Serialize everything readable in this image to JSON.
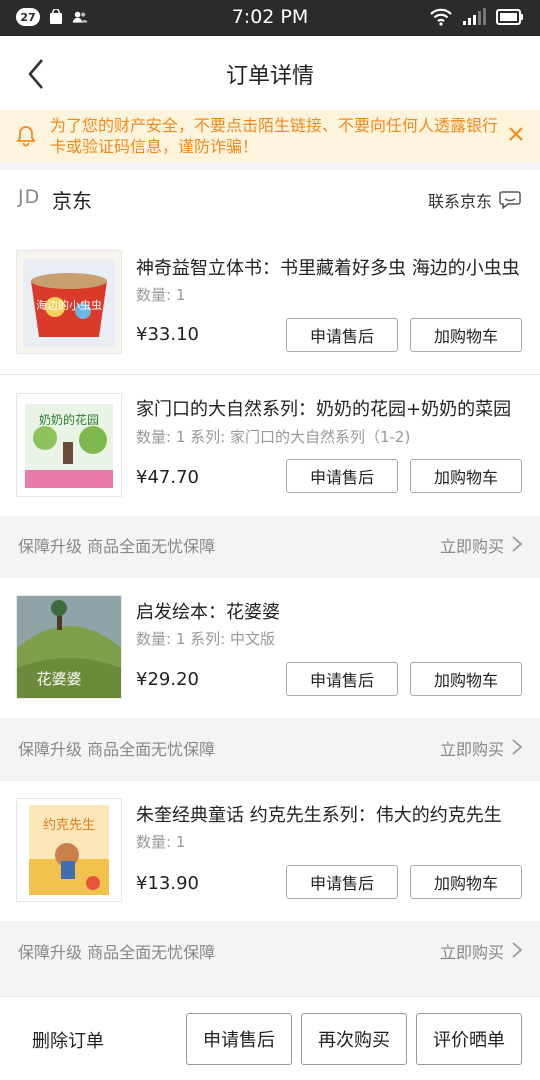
{
  "status_bar": {
    "notif_count": "27",
    "time": "7:02 PM"
  },
  "nav": {
    "title": "订单详情"
  },
  "warning": {
    "text": "为了您的财产安全，不要点击陌生链接、不要向任何人透露银行卡或验证码信息，谨防诈骗！"
  },
  "shop": {
    "logo": "JD",
    "name": "京东",
    "contact": "联系京东"
  },
  "items": [
    {
      "name": "神奇益智立体书：书里藏着好多虫 海边的小虫虫",
      "qty": "数量: 1",
      "price": "¥33.10",
      "after_sale": "申请售后",
      "add_cart": "加购物车"
    },
    {
      "name": "家门口的大自然系列：奶奶的花园+奶奶的菜园",
      "qty": "数量: 1 系列: 家门口的大自然系列（1-2)",
      "price": "¥47.70",
      "after_sale": "申请售后",
      "add_cart": "加购物车"
    },
    {
      "name": "启发绘本：花婆婆",
      "qty": "数量: 1 系列: 中文版",
      "price": "¥29.20",
      "after_sale": "申请售后",
      "add_cart": "加购物车"
    },
    {
      "name": "朱奎经典童话 约克先生系列：伟大的约克先生",
      "qty": "数量: 1",
      "price": "¥13.90",
      "after_sale": "申请售后",
      "add_cart": "加购物车"
    }
  ],
  "guarantee": {
    "text": "保障升级 商品全面无忧保障",
    "buy": "立即购买"
  },
  "book_covers": {
    "cover1": "海边的小虫虫",
    "cover2": "奶奶的花园",
    "cover3": "花婆婆",
    "cover4": "约克先生"
  },
  "bottom": {
    "delete": "删除订单",
    "after_sale": "申请售后",
    "rebuy": "再次购买",
    "review": "评价晒单"
  }
}
